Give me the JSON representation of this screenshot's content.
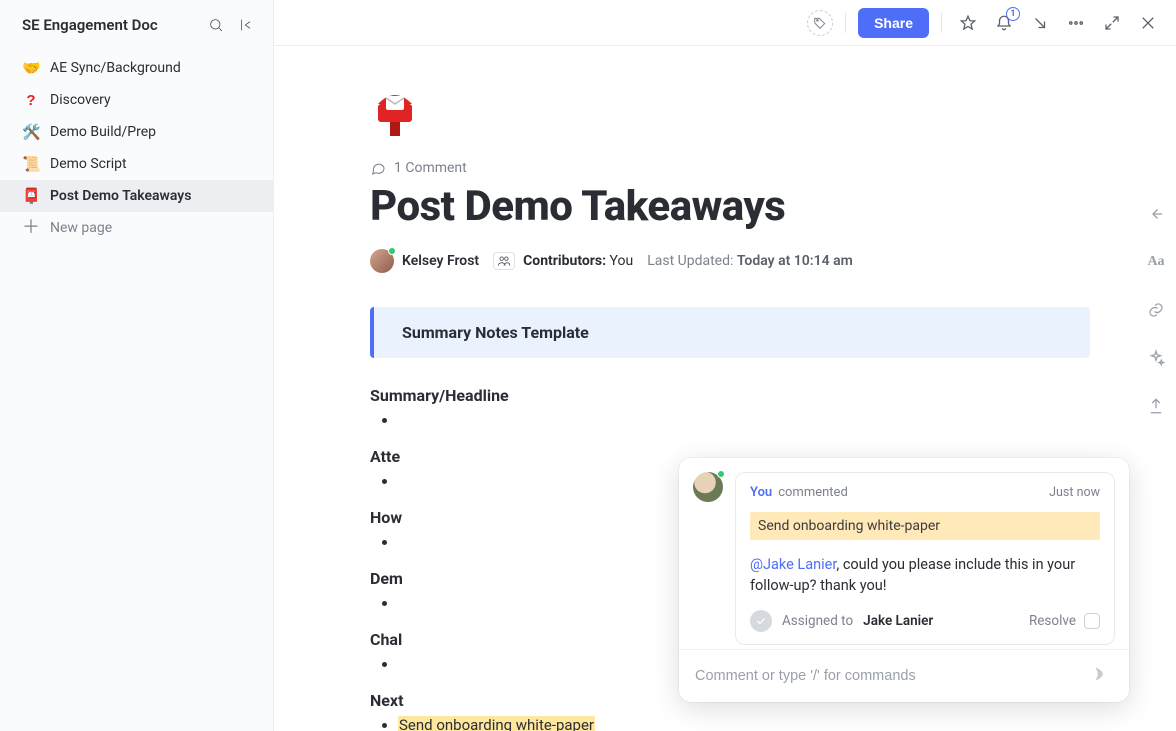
{
  "sidebar": {
    "title": "SE Engagement Doc",
    "items": [
      {
        "emoji": "🤝",
        "label": "AE Sync/Background"
      },
      {
        "emoji": "?",
        "label": "Discovery",
        "red": true
      },
      {
        "emoji": "🛠️",
        "label": "Demo Build/Prep"
      },
      {
        "emoji": "📜",
        "label": "Demo Script"
      },
      {
        "emoji": "📮",
        "label": "Post Demo Takeaways",
        "active": true
      }
    ],
    "new_page": "New page"
  },
  "topbar": {
    "share": "Share",
    "bell_count": "1"
  },
  "doc": {
    "comment_count": "1 Comment",
    "title": "Post Demo Takeaways",
    "author": "Kelsey Frost",
    "contributors_label": "Contributors:",
    "contributors_value": "You",
    "updated_label": "Last Updated:",
    "updated_value": "Today at 10:14 am",
    "callout": "Summary Notes Template",
    "sections": [
      {
        "h": "Summary/Headline"
      },
      {
        "h": "Atte"
      },
      {
        "h": "How"
      },
      {
        "h": "Dem"
      },
      {
        "h": "Chal"
      },
      {
        "h": "Next"
      }
    ],
    "highlight_bullet": "Send onboarding white-paper"
  },
  "popover": {
    "you": "You",
    "action": "commented",
    "time": "Just now",
    "quote": "Send onboarding white-paper",
    "mention": "@Jake Lanier",
    "message_tail": ", could you please include this in your follow-up? thank you!",
    "assigned_label": "Assigned to",
    "assignee": "Jake Lanier",
    "resolve": "Resolve",
    "placeholder": "Comment or type '/' for commands"
  },
  "rail": {
    "aa": "Aa"
  }
}
